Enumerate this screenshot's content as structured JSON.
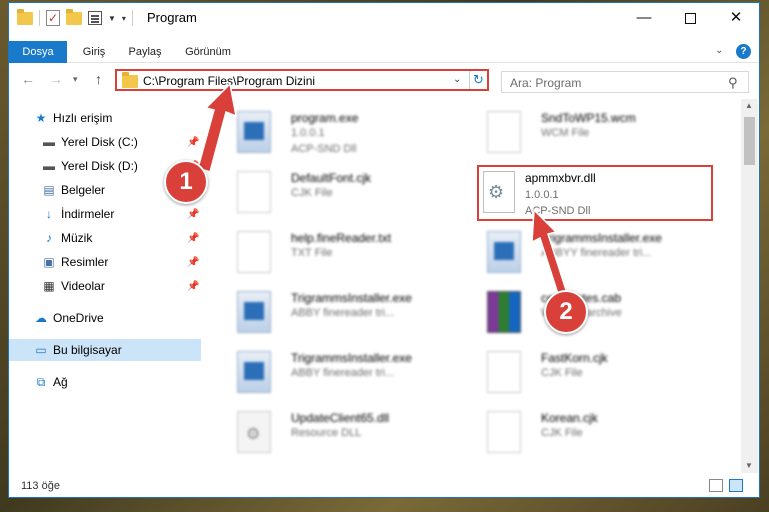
{
  "window": {
    "title": "Program"
  },
  "ribbon": {
    "tabs": [
      "Dosya",
      "Giriş",
      "Paylaş",
      "Görünüm"
    ],
    "help": "?"
  },
  "nav": {
    "address": "C:\\Program Files\\Program Dizini",
    "search_placeholder": "Ara: Program"
  },
  "sidebar": {
    "items": [
      {
        "label": "Hızlı erişim",
        "icon": "star-icon"
      },
      {
        "label": "Yerel Disk (C:)",
        "icon": "drive-icon"
      },
      {
        "label": "Yerel Disk (D:)",
        "icon": "drive-icon"
      },
      {
        "label": "Belgeler",
        "icon": "documents-icon"
      },
      {
        "label": "İndirmeler",
        "icon": "download-icon"
      },
      {
        "label": "Müzik",
        "icon": "music-icon"
      },
      {
        "label": "Resimler",
        "icon": "pictures-icon"
      },
      {
        "label": "Videolar",
        "icon": "video-icon"
      },
      {
        "label": "OneDrive",
        "icon": "cloud-icon"
      },
      {
        "label": "Bu bilgisayar",
        "icon": "computer-icon"
      },
      {
        "label": "Ağ",
        "icon": "network-icon"
      }
    ]
  },
  "files": {
    "f0": {
      "name": "program.exe",
      "line1": "1.0.0.1",
      "line2": "ACP-SND Dll"
    },
    "f1": {
      "name": "SndToWP15.wcm",
      "line1": "WCM File",
      "line2": ""
    },
    "f2": {
      "name": "DefaultFont.cjk",
      "line1": "CJK File",
      "line2": ""
    },
    "f3": {
      "name": "apmmxbvr.dll",
      "line1": "1.0.0.1",
      "line2": "ACP-SND Dll"
    },
    "f4": {
      "name": "help.fineReader.txt",
      "line1": "TXT File",
      "line2": ""
    },
    "f5": {
      "name": "TrigrammsInstaller.exe",
      "line1": "ABBYY finereader tri...",
      "line2": ""
    },
    "f6": {
      "name": "TrigrammsInstaller.exe",
      "line1": "ABBY finereader tri...",
      "line2": ""
    },
    "f7": {
      "name": "certificates.cab",
      "line1": "WinRAR archive",
      "line2": ""
    },
    "f8": {
      "name": "TrigrammsInstaller.exe",
      "line1": "ABBY finereader tri...",
      "line2": ""
    },
    "f9": {
      "name": "FastKorn.cjk",
      "line1": "CJK File",
      "line2": ""
    },
    "f10": {
      "name": "UpdateClient65.dll",
      "line1": "Resource DLL",
      "line2": ""
    },
    "f11": {
      "name": "Korean.cjk",
      "line1": "CJK File",
      "line2": ""
    }
  },
  "status": {
    "count": "113 öğe"
  },
  "annotations": {
    "badge1": "1",
    "badge2": "2"
  },
  "colors": {
    "accent": "#1979ca",
    "highlight": "#d9403a",
    "selected": "#cce4f7"
  }
}
